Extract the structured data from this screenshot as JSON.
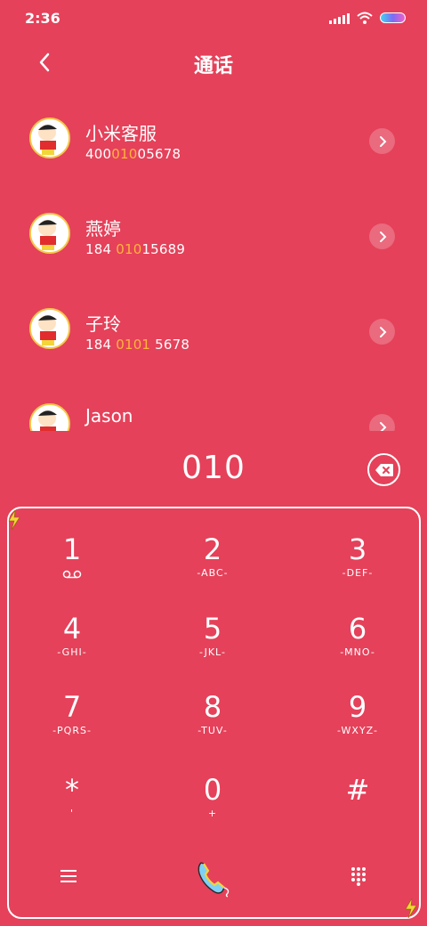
{
  "status": {
    "time": "2:36"
  },
  "nav": {
    "title": "通话"
  },
  "contacts": [
    {
      "name": "小米客服",
      "num_pre": "400",
      "num_hl": "010",
      "num_post": "05678"
    },
    {
      "name": "燕婷",
      "num_pre": "184 ",
      "num_hl": "010",
      "num_post": "15689"
    },
    {
      "name": "子玲",
      "num_pre": "184 ",
      "num_hl": "0101",
      "num_post": " 5678"
    },
    {
      "name": "Jason",
      "num_pre": "",
      "num_hl": "",
      "num_post": ""
    }
  ],
  "dialer": {
    "digits": "010"
  },
  "keys": [
    {
      "num": "1",
      "letters": ""
    },
    {
      "num": "2",
      "letters": "-ABC-"
    },
    {
      "num": "3",
      "letters": "-DEF-"
    },
    {
      "num": "4",
      "letters": "-GHI-"
    },
    {
      "num": "5",
      "letters": "-JKL-"
    },
    {
      "num": "6",
      "letters": "-MNO-"
    },
    {
      "num": "7",
      "letters": "-PQRS-"
    },
    {
      "num": "8",
      "letters": "-TUV-"
    },
    {
      "num": "9",
      "letters": "-WXYZ-"
    },
    {
      "num": "*",
      "letters": "'"
    },
    {
      "num": "0",
      "letters": "+"
    },
    {
      "num": "#",
      "letters": ""
    }
  ],
  "icons": {
    "back": "chevron-left-icon",
    "voicemail": "voicemail-icon",
    "delete": "backspace-icon",
    "menu": "menu-icon",
    "call": "phone-icon",
    "keypad": "keypad-icon"
  },
  "colors": {
    "background": "#e5415a",
    "highlight": "#ffb43a",
    "avatar_border": "#f5c74a"
  }
}
